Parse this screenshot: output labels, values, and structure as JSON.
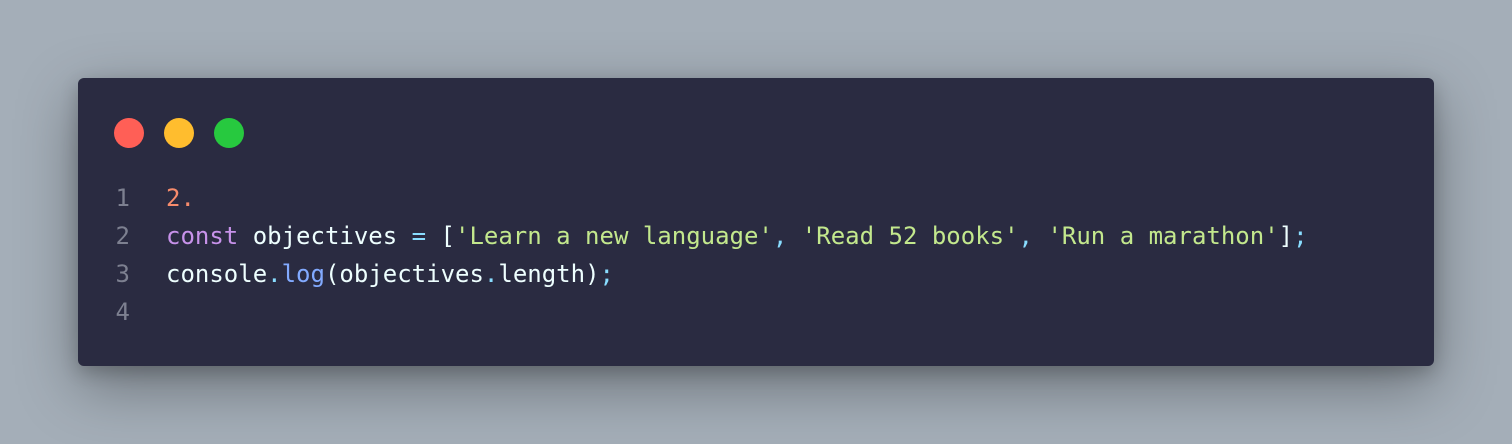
{
  "window": {
    "controls": [
      {
        "name": "close",
        "color": "#ff5f56"
      },
      {
        "name": "minimize",
        "color": "#ffbd2e"
      },
      {
        "name": "maximize",
        "color": "#27c93f"
      }
    ]
  },
  "code": {
    "lines": [
      {
        "number": "1",
        "tokens": [
          {
            "type": "num",
            "text": "2."
          }
        ]
      },
      {
        "number": "2",
        "tokens": [
          {
            "type": "kw",
            "text": "const"
          },
          {
            "type": "var",
            "text": " objectives "
          },
          {
            "type": "op",
            "text": "="
          },
          {
            "type": "var",
            "text": " "
          },
          {
            "type": "bracket",
            "text": "["
          },
          {
            "type": "str",
            "text": "'Learn a new language'"
          },
          {
            "type": "punc",
            "text": ","
          },
          {
            "type": "var",
            "text": " "
          },
          {
            "type": "str",
            "text": "'Read 52 books'"
          },
          {
            "type": "punc",
            "text": ","
          },
          {
            "type": "var",
            "text": " "
          },
          {
            "type": "str",
            "text": "'Run a marathon'"
          },
          {
            "type": "bracket",
            "text": "]"
          },
          {
            "type": "punc",
            "text": ";"
          }
        ]
      },
      {
        "number": "3",
        "tokens": [
          {
            "type": "var",
            "text": "console"
          },
          {
            "type": "punc",
            "text": "."
          },
          {
            "type": "fn",
            "text": "log"
          },
          {
            "type": "bracket",
            "text": "("
          },
          {
            "type": "var",
            "text": "objectives"
          },
          {
            "type": "punc",
            "text": "."
          },
          {
            "type": "prop",
            "text": "length"
          },
          {
            "type": "bracket",
            "text": ")"
          },
          {
            "type": "punc",
            "text": ";"
          }
        ]
      },
      {
        "number": "4",
        "tokens": []
      }
    ]
  }
}
